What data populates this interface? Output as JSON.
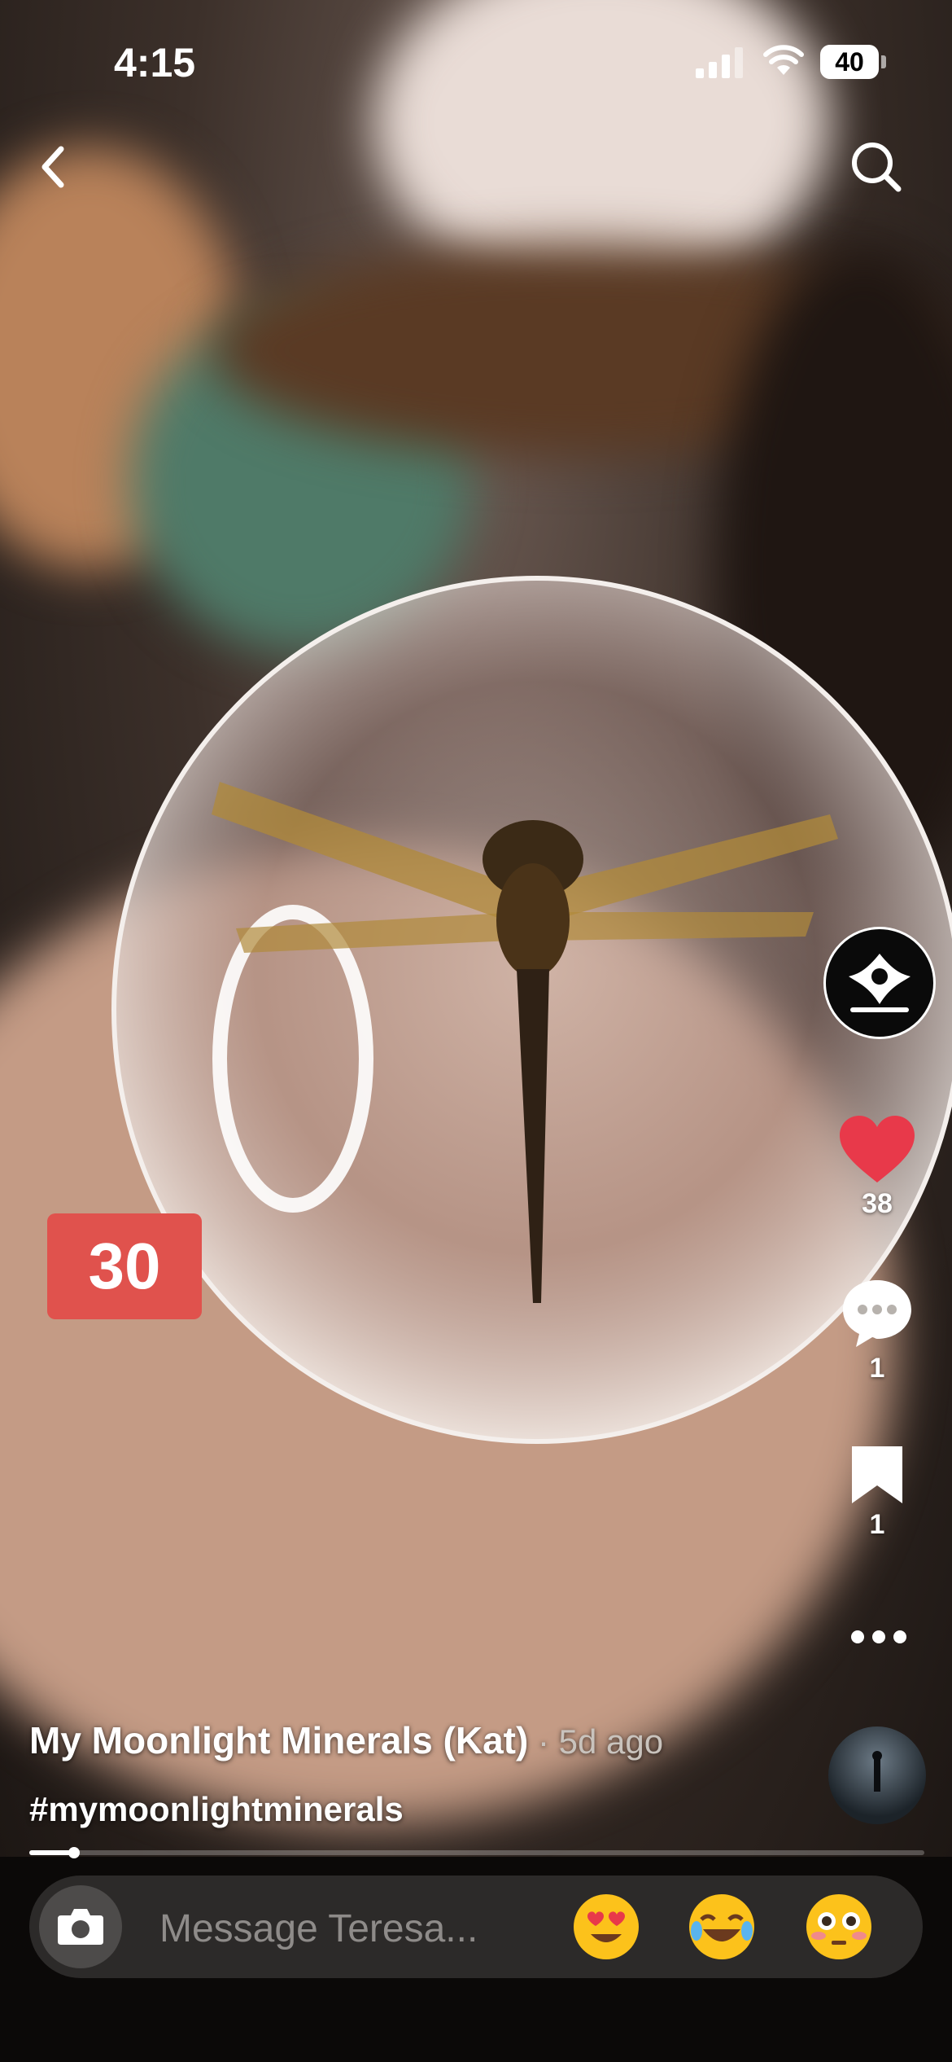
{
  "status_bar": {
    "time": "4:15",
    "battery": "40"
  },
  "rail": {
    "likes": "38",
    "comments": "1",
    "saves": "1"
  },
  "timer_badge": "30",
  "caption": {
    "author": "My Moonlight Minerals (Kat)",
    "posted": " · 5d ago"
  },
  "hashtag": "#mymoonlightminerals",
  "progress": {
    "fraction": 0.05
  },
  "message_bar": {
    "placeholder": "Message Teresa..."
  },
  "colors": {
    "like": "#e8394a",
    "badge": "#e0524d"
  },
  "icons": [
    "back-icon",
    "search-icon",
    "heart-icon",
    "comment-icon",
    "bookmark-icon",
    "more-icon",
    "camera-icon"
  ]
}
